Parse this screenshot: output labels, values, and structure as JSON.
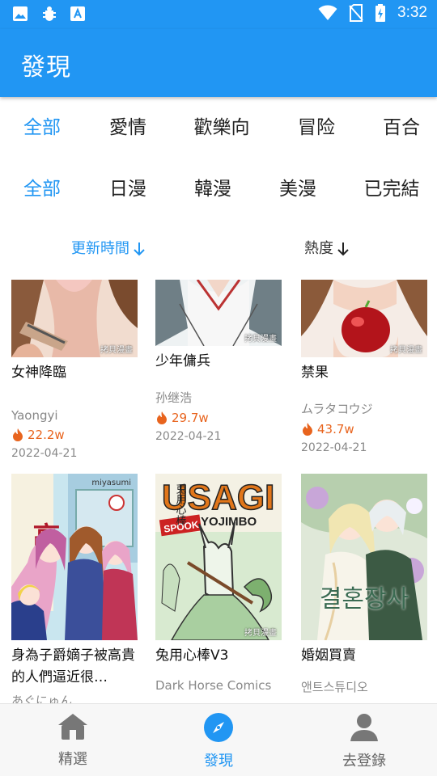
{
  "status_bar": {
    "time": "3:32"
  },
  "app_bar": {
    "title": "發現"
  },
  "filters": {
    "categories": [
      "全部",
      "愛情",
      "歡樂向",
      "冒险",
      "百合"
    ],
    "regions": [
      "全部",
      "日漫",
      "韓漫",
      "美漫",
      "已完結"
    ],
    "sort": {
      "updated": "更新時間",
      "popularity": "熱度"
    }
  },
  "comics": [
    {
      "title": "女神降臨",
      "author": "Yaongyi",
      "popularity": "22.2w",
      "date": "2022-04-21",
      "watermark": "拷貝漫畫"
    },
    {
      "title": "少年傭兵",
      "author": "孙继浩",
      "popularity": "29.7w",
      "date": "2022-04-21",
      "watermark": "拷貝漫畫"
    },
    {
      "title": "禁果",
      "author": "ムラタコウジ",
      "popularity": "43.7w",
      "date": "2022-04-21",
      "watermark": "拷貝漫畫"
    },
    {
      "title": "身為子爵嫡子被高貴的人們逼近很…",
      "author": "あぐにゅん",
      "cover_text": "子爵嫡子 高貴な人たち 困る",
      "watermark": "miyasumi"
    },
    {
      "title": "兔用心棒V3",
      "author": "Dark Horse Comics",
      "cover_text": "USAGI",
      "cover_subtext": "YOJIMBO",
      "cover_badge": "SPOOK",
      "cover_vertical": "兎用心棒",
      "watermark": "拷貝漫畫"
    },
    {
      "title": "婚姻買賣",
      "author": "앤트스튜디오",
      "cover_text": "결혼장사"
    }
  ],
  "bottom_nav": [
    {
      "label": "精選",
      "icon": "home-icon"
    },
    {
      "label": "發現",
      "icon": "compass-icon"
    },
    {
      "label": "去登錄",
      "icon": "person-icon"
    }
  ],
  "colors": {
    "primary": "#2196f3",
    "hot": "#e8641e"
  }
}
